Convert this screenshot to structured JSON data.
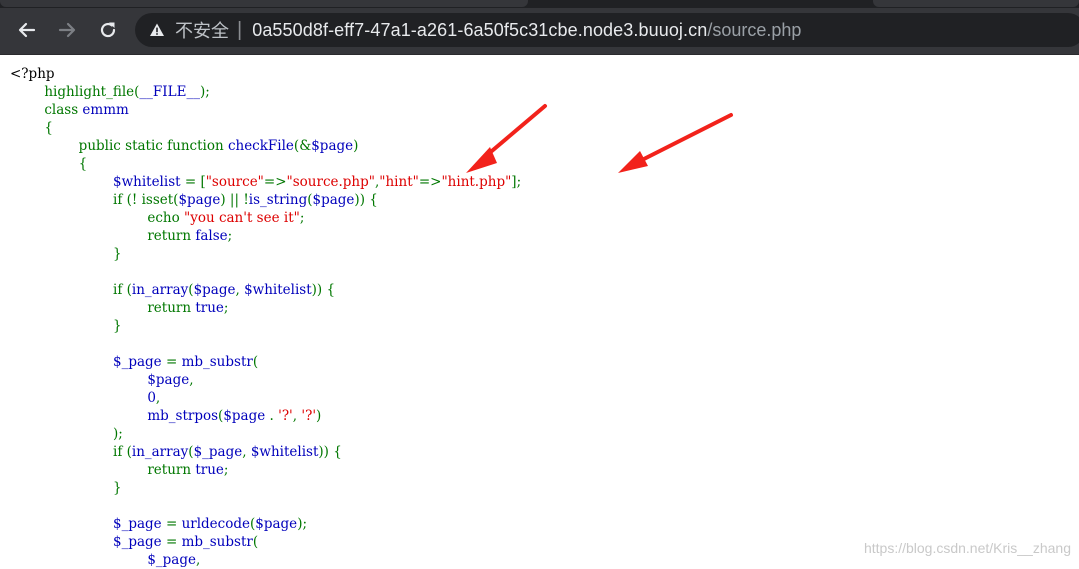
{
  "browser": {
    "security_label": "不安全",
    "url_separator": "|",
    "url_host": "0a550d8f-eff7-47a1-a261-6a50f5c31cbe.node3.buuoj.cn",
    "url_path": "/source.php",
    "icons": {
      "back": "arrow-left-icon",
      "forward": "arrow-right-icon",
      "reload": "reload-icon",
      "security": "warning-triangle-icon"
    },
    "colors": {
      "chrome": "#35363a",
      "omnibox": "#202124"
    }
  },
  "code": {
    "colors": {
      "html": "#000000",
      "keyword": "#007700",
      "string": "#DD0000",
      "default": "#0000BB"
    },
    "lines": [
      [
        {
          "t": "html",
          "v": "<?php"
        }
      ],
      [
        {
          "t": "default",
          "v": "        "
        },
        {
          "t": "keyword",
          "v": "highlight_file("
        },
        {
          "t": "default",
          "v": "__FILE__"
        },
        {
          "t": "keyword",
          "v": ");"
        }
      ],
      [
        {
          "t": "default",
          "v": "        "
        },
        {
          "t": "keyword",
          "v": "class "
        },
        {
          "t": "default",
          "v": "emmm"
        }
      ],
      [
        {
          "t": "default",
          "v": "        "
        },
        {
          "t": "keyword",
          "v": "{"
        }
      ],
      [
        {
          "t": "default",
          "v": "                "
        },
        {
          "t": "keyword",
          "v": "public static function "
        },
        {
          "t": "default",
          "v": "checkFile"
        },
        {
          "t": "keyword",
          "v": "(&"
        },
        {
          "t": "default",
          "v": "$page"
        },
        {
          "t": "keyword",
          "v": ")"
        }
      ],
      [
        {
          "t": "default",
          "v": "                "
        },
        {
          "t": "keyword",
          "v": "{"
        }
      ],
      [
        {
          "t": "default",
          "v": "                        $whitelist "
        },
        {
          "t": "keyword",
          "v": "= ["
        },
        {
          "t": "string",
          "v": "\"source\""
        },
        {
          "t": "keyword",
          "v": "=>"
        },
        {
          "t": "string",
          "v": "\"source.php\""
        },
        {
          "t": "keyword",
          "v": ","
        },
        {
          "t": "string",
          "v": "\"hint\""
        },
        {
          "t": "keyword",
          "v": "=>"
        },
        {
          "t": "string",
          "v": "\"hint.php\""
        },
        {
          "t": "keyword",
          "v": "];"
        }
      ],
      [
        {
          "t": "default",
          "v": "                        "
        },
        {
          "t": "keyword",
          "v": "if (! isset("
        },
        {
          "t": "default",
          "v": "$page"
        },
        {
          "t": "keyword",
          "v": ") || !"
        },
        {
          "t": "default",
          "v": "is_string"
        },
        {
          "t": "keyword",
          "v": "("
        },
        {
          "t": "default",
          "v": "$page"
        },
        {
          "t": "keyword",
          "v": ")) {"
        }
      ],
      [
        {
          "t": "default",
          "v": "                                "
        },
        {
          "t": "keyword",
          "v": "echo "
        },
        {
          "t": "string",
          "v": "\"you can't see it\""
        },
        {
          "t": "keyword",
          "v": ";"
        }
      ],
      [
        {
          "t": "default",
          "v": "                                "
        },
        {
          "t": "keyword",
          "v": "return "
        },
        {
          "t": "default",
          "v": "false"
        },
        {
          "t": "keyword",
          "v": ";"
        }
      ],
      [
        {
          "t": "default",
          "v": "                        "
        },
        {
          "t": "keyword",
          "v": "}"
        }
      ],
      [],
      [
        {
          "t": "default",
          "v": "                        "
        },
        {
          "t": "keyword",
          "v": "if ("
        },
        {
          "t": "default",
          "v": "in_array"
        },
        {
          "t": "keyword",
          "v": "("
        },
        {
          "t": "default",
          "v": "$page"
        },
        {
          "t": "keyword",
          "v": ", "
        },
        {
          "t": "default",
          "v": "$whitelist"
        },
        {
          "t": "keyword",
          "v": ")) {"
        }
      ],
      [
        {
          "t": "default",
          "v": "                                "
        },
        {
          "t": "keyword",
          "v": "return "
        },
        {
          "t": "default",
          "v": "true"
        },
        {
          "t": "keyword",
          "v": ";"
        }
      ],
      [
        {
          "t": "default",
          "v": "                        "
        },
        {
          "t": "keyword",
          "v": "}"
        }
      ],
      [],
      [
        {
          "t": "default",
          "v": "                        $_page "
        },
        {
          "t": "keyword",
          "v": "= "
        },
        {
          "t": "default",
          "v": "mb_substr"
        },
        {
          "t": "keyword",
          "v": "("
        }
      ],
      [
        {
          "t": "default",
          "v": "                                $page"
        },
        {
          "t": "keyword",
          "v": ","
        }
      ],
      [
        {
          "t": "default",
          "v": "                                0"
        },
        {
          "t": "keyword",
          "v": ","
        }
      ],
      [
        {
          "t": "default",
          "v": "                                mb_strpos"
        },
        {
          "t": "keyword",
          "v": "("
        },
        {
          "t": "default",
          "v": "$page "
        },
        {
          "t": "keyword",
          "v": ". "
        },
        {
          "t": "string",
          "v": "'?'"
        },
        {
          "t": "keyword",
          "v": ", "
        },
        {
          "t": "string",
          "v": "'?'"
        },
        {
          "t": "keyword",
          "v": ")"
        }
      ],
      [
        {
          "t": "default",
          "v": "                        "
        },
        {
          "t": "keyword",
          "v": ");"
        }
      ],
      [
        {
          "t": "default",
          "v": "                        "
        },
        {
          "t": "keyword",
          "v": "if ("
        },
        {
          "t": "default",
          "v": "in_array"
        },
        {
          "t": "keyword",
          "v": "("
        },
        {
          "t": "default",
          "v": "$_page"
        },
        {
          "t": "keyword",
          "v": ", "
        },
        {
          "t": "default",
          "v": "$whitelist"
        },
        {
          "t": "keyword",
          "v": ")) {"
        }
      ],
      [
        {
          "t": "default",
          "v": "                                "
        },
        {
          "t": "keyword",
          "v": "return "
        },
        {
          "t": "default",
          "v": "true"
        },
        {
          "t": "keyword",
          "v": ";"
        }
      ],
      [
        {
          "t": "default",
          "v": "                        "
        },
        {
          "t": "keyword",
          "v": "}"
        }
      ],
      [],
      [
        {
          "t": "default",
          "v": "                        $_page "
        },
        {
          "t": "keyword",
          "v": "= "
        },
        {
          "t": "default",
          "v": "urldecode"
        },
        {
          "t": "keyword",
          "v": "("
        },
        {
          "t": "default",
          "v": "$page"
        },
        {
          "t": "keyword",
          "v": ");"
        }
      ],
      [
        {
          "t": "default",
          "v": "                        $_page "
        },
        {
          "t": "keyword",
          "v": "= "
        },
        {
          "t": "default",
          "v": "mb_substr"
        },
        {
          "t": "keyword",
          "v": "("
        }
      ],
      [
        {
          "t": "default",
          "v": "                                $_page"
        },
        {
          "t": "keyword",
          "v": ","
        }
      ]
    ]
  },
  "annotation": {
    "arrow_color": "#f2221b",
    "arrow_count": 2
  },
  "watermark": "https://blog.csdn.net/Kris__zhang"
}
